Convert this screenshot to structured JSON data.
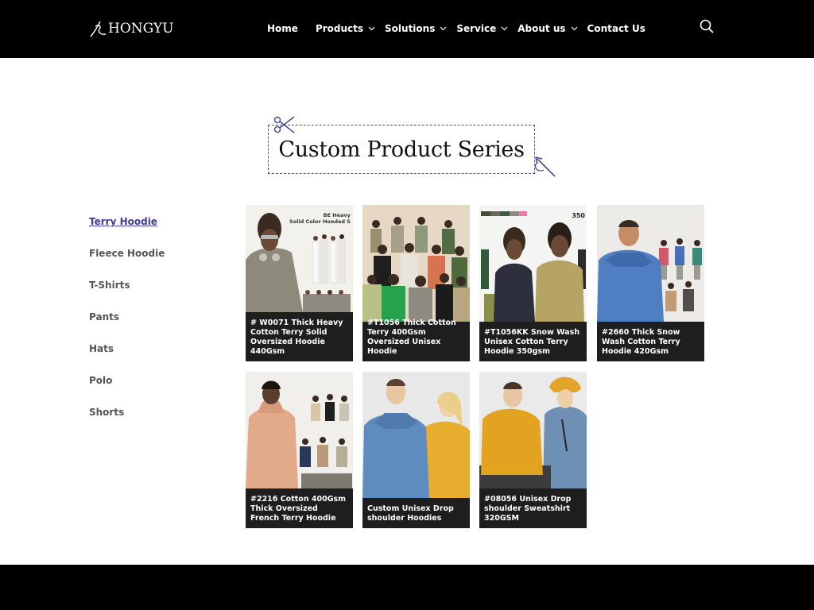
{
  "brand": {
    "logo_text": "HONGYU"
  },
  "nav": {
    "items": [
      {
        "label": "Home"
      },
      {
        "label": "Products"
      },
      {
        "label": "Solutions"
      },
      {
        "label": "Service"
      },
      {
        "label": "About us"
      },
      {
        "label": "Contact Us"
      }
    ]
  },
  "section": {
    "title": "Custom Product Series"
  },
  "sidebar": {
    "items": [
      {
        "label": "Terry Hoodie",
        "active": true
      },
      {
        "label": "Fleece Hoodie"
      },
      {
        "label": "T-Shirts"
      },
      {
        "label": "Pants"
      },
      {
        "label": "Hats"
      },
      {
        "label": "Polo"
      },
      {
        "label": "Shorts"
      }
    ]
  },
  "products": [
    {
      "caption": "# W0071 Thick Heavy Cotton Terry Solid Oversized Hoodie 440Gsm",
      "image_text": "BE Heavy Solid Color Hooded S"
    },
    {
      "caption": "#T1056 Thick Cotton Terry 400Gsm Oversized Unisex Hoodie"
    },
    {
      "caption": "#T1056KK Snow Wash Unisex Cotton Terry Hoodie 350gsm",
      "image_text": "350"
    },
    {
      "caption": "#2660 Thick Snow Wash Cotton Terry Hoodie 420Gsm"
    },
    {
      "caption": "#2216 Cotton 400Gsm Thick Oversized French Terry Hoodie"
    },
    {
      "caption": "Custom Unisex Drop shoulder Hoodies"
    },
    {
      "caption": "#08056 Unisex Drop shoulder Sweatshirt 320GSM"
    }
  ],
  "colors": {
    "header_bg": "#000000",
    "accent": "#3d3a9e",
    "card_bg": "#1e1e1e"
  }
}
